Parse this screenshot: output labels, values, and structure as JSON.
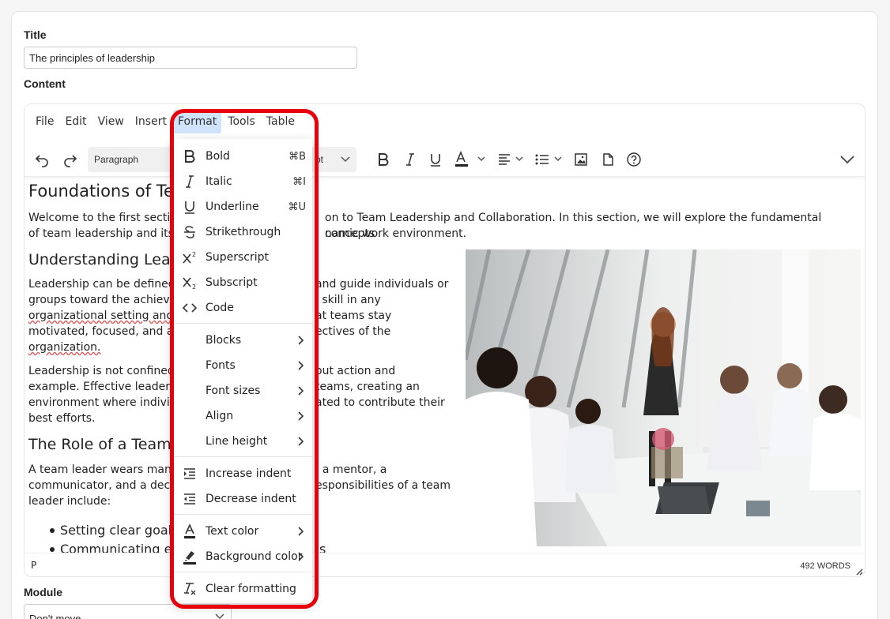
{
  "form": {
    "title_label": "Title",
    "title_value": "The principles of leadership",
    "content_label": "Content",
    "module_label": "Module",
    "module_value": "Don't move"
  },
  "editor": {
    "menubar": [
      "File",
      "Edit",
      "View",
      "Insert",
      "Format",
      "Tools",
      "Table"
    ],
    "block_format": "Paragraph",
    "font_size_visible": "pt",
    "status_path": "P",
    "word_count": "492 WORDS"
  },
  "content": {
    "h1": "Foundations of Te",
    "intro_line1": "Welcome to the first sectio",
    "intro_line1_end": "on to Team Leadership and Collaboration. In this section, we will explore the fundamental concepts",
    "intro_line2": "of team leadership and its",
    "intro_line2_end": "namic work environment.",
    "h2_understanding": "Understanding Lea",
    "p1_l1a": "Leadership can be defined",
    "p1_l1b": "and guide individuals or",
    "p1_l2a": "groups toward the achieve",
    "p1_l2b": "l skill in any",
    "p1_l3a": "organizational setting and",
    "p1_l3b": "at teams stay",
    "p1_l4a": "motivated, focused, and a",
    "p1_l4b": "ectives of the",
    "p1_l5a": "organization.",
    "p2_l1a": "Leadership is not confined",
    "p2_l1b": "out action and",
    "p2_l2a": "example. Effective leaders",
    "p2_l2b": "teams, creating an",
    "p2_l3a": "environment where individ",
    "p2_l3b": "ated to contribute their",
    "p2_l4a": "best efforts.",
    "h2_role": "The Role of a Team",
    "p3_l1a": "A team leader wears man",
    "p3_l1b": ", a mentor, a",
    "p3_l2a": "communicator, and a dec",
    "p3_l2b": "esponsibilities of a team",
    "p3_l3a": "leader include:",
    "bullet1": "Setting clear goals a",
    "bullet2": "Communicating effe",
    "bullet2_end": "s"
  },
  "format_menu": {
    "items": [
      {
        "label": "Bold",
        "shortcut": "⌘B",
        "icon": "bold-icon"
      },
      {
        "label": "Italic",
        "shortcut": "⌘I",
        "icon": "italic-icon"
      },
      {
        "label": "Underline",
        "shortcut": "⌘U",
        "icon": "underline-icon"
      },
      {
        "label": "Strikethrough",
        "icon": "strikethrough-icon"
      },
      {
        "label": "Superscript",
        "icon": "superscript-icon"
      },
      {
        "label": "Subscript",
        "icon": "subscript-icon"
      },
      {
        "label": "Code",
        "icon": "code-icon"
      },
      {
        "label": "Blocks",
        "submenu": true
      },
      {
        "label": "Fonts",
        "submenu": true
      },
      {
        "label": "Font sizes",
        "submenu": true
      },
      {
        "label": "Align",
        "submenu": true
      },
      {
        "label": "Line height",
        "submenu": true
      },
      {
        "label": "Increase indent",
        "icon": "increase-indent-icon"
      },
      {
        "label": "Decrease indent",
        "icon": "decrease-indent-icon"
      },
      {
        "label": "Text color",
        "icon": "text-color-icon",
        "submenu": true
      },
      {
        "label": "Background color",
        "icon": "background-color-icon",
        "submenu": true
      },
      {
        "label": "Clear formatting",
        "icon": "clear-formatting-icon"
      }
    ]
  },
  "colors": {
    "highlight_border": "#e8000b",
    "active_menu_bg": "#cfe3fb"
  }
}
